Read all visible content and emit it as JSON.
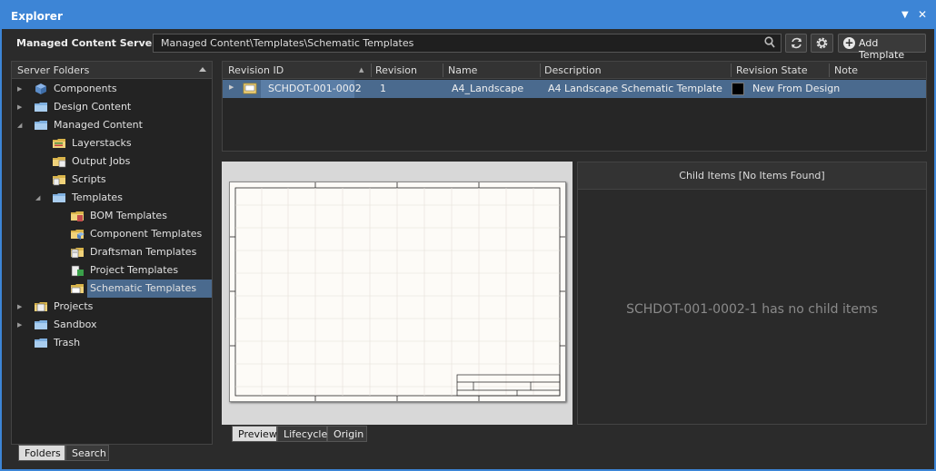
{
  "window": {
    "title": "Explorer"
  },
  "toolbar": {
    "server_label": "Managed Content Server",
    "path": "Managed Content\\Templates\\Schematic Templates",
    "add_template_label": "Add Template",
    "icons": [
      "search-icon",
      "refresh-icon",
      "gear-icon",
      "plus-circle-icon"
    ]
  },
  "left": {
    "header": "Server Folders",
    "items": [
      {
        "label": "Components",
        "icon": "components-icon"
      },
      {
        "label": "Design Content",
        "icon": "folder-icon"
      },
      {
        "label": "Managed Content",
        "icon": "folder-icon"
      },
      {
        "label": "Layerstacks",
        "icon": "layerstack-folder-icon"
      },
      {
        "label": "Output Jobs",
        "icon": "outputjob-folder-icon"
      },
      {
        "label": "Scripts",
        "icon": "script-folder-icon"
      },
      {
        "label": "Templates",
        "icon": "folder-icon"
      },
      {
        "label": "BOM Templates",
        "icon": "bom-template-folder-icon"
      },
      {
        "label": "Component Templates",
        "icon": "component-template-folder-icon"
      },
      {
        "label": "Draftsman Templates",
        "icon": "draftsman-template-folder-icon"
      },
      {
        "label": "Project Templates",
        "icon": "project-template-folder-icon"
      },
      {
        "label": "Schematic Templates",
        "icon": "schematic-template-folder-icon"
      },
      {
        "label": "Projects",
        "icon": "projects-icon"
      },
      {
        "label": "Sandbox",
        "icon": "folder-icon"
      },
      {
        "label": "Trash",
        "icon": "folder-icon"
      }
    ],
    "tabs": [
      "Folders",
      "Search"
    ]
  },
  "grid": {
    "columns": [
      "Revision ID",
      "Revision",
      "Name",
      "Description",
      "Revision State",
      "Note"
    ],
    "row": {
      "revision_id": "SCHDOT-001-0002",
      "revision": "1",
      "name": "A4_Landscape",
      "description": "A4 Landscape Schematic Template",
      "revision_state": "New From Design",
      "note": ""
    }
  },
  "preview": {
    "tabs": [
      "Preview",
      "Lifecycle",
      "Origin"
    ]
  },
  "child": {
    "header": "Child Items [No Items Found]",
    "empty": "SCHDOT-001-0002-1 has no child items"
  },
  "colors": {
    "accent": "#3d85d6",
    "selection": "#4a6a8e",
    "panel": "#2b2b2b"
  }
}
